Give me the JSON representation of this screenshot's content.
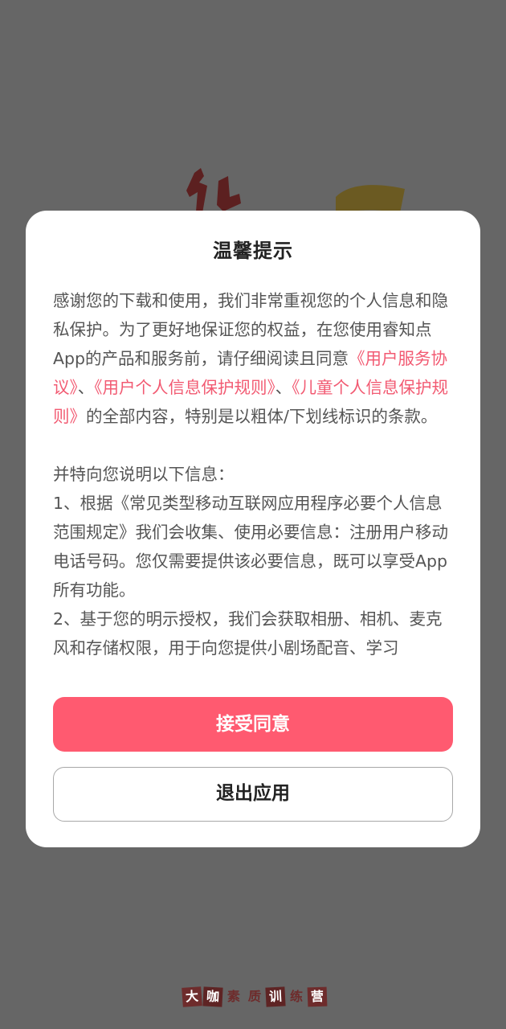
{
  "colors": {
    "overlay": "#666666",
    "accent": "#ff5a70",
    "link": "#f25a72"
  },
  "dialog": {
    "title": "温馨提示",
    "intro": {
      "text_before": "感谢您的下载和使用，我们非常重视您的个人信息和隐私保护。为了更好地保证您的权益，在您使用睿知点App的产品和服务前，请仔细阅读且同意",
      "link_user_agreement": "《用户服务协议》",
      "sep1": "、",
      "link_privacy_rules": "《用户个人信息保护规则》",
      "sep2": "、",
      "link_children_rules": "《儿童个人信息保护规则》",
      "text_after": "的全部内容，特别是以粗体/下划线标识的条款。"
    },
    "details_heading": "并特向您说明以下信息：",
    "item1": "1、根据《常见类型移动互联网应用程序必要个人信息范围规定》我们会收集、使用必要信息：注册用户移动电话号码。您仅需要提供该必要信息，既可以享受App所有功能。",
    "item2": "2、基于您的明示授权，我们会获取相册、相机、麦克风和存储权限，用于向您提供小剧场配音、学习",
    "accept_label": "接受同意",
    "exit_label": "退出应用"
  },
  "background": {
    "bottom_brand": [
      "大",
      "咖",
      "素",
      "质",
      "训",
      "练",
      "营"
    ]
  }
}
